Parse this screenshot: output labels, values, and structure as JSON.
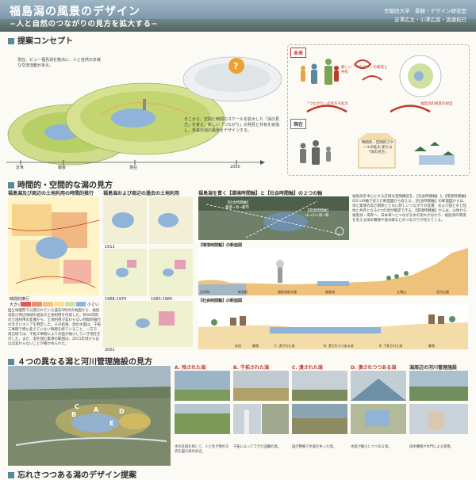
{
  "header": {
    "title": "福島潟の風景のデザイン",
    "subtitle": "−人と自然のつながりの見方を拡大する−",
    "affil_line1": "早稲田大学　景観・デザイン研究室",
    "affil_line2": "吉澤広太・小澤広嵩・渡邉拓巳"
  },
  "sections": {
    "s1": "提案コンセプト",
    "s2": "時間的・空間的な潟の見方",
    "s3": "４つの異なる潟と河川管理施設の見方",
    "s4": "忘れさつつある潟のデザイン提案"
  },
  "concept": {
    "text_now": "現在、ビュー福島潟を拠点に、人と自然の多様な交流活動がある。",
    "text_future": "そこから、空間と時間のスケールを拡大した「潟の見方」を考え、新しい「つながり」の発見と共有を目指し、未来の潟の風景をデザインする。",
    "timeline": [
      "近世",
      "戦後",
      "現在",
      "2050"
    ],
    "future_label": "未来",
    "present_label": "現在",
    "cycle_center": "時間的・空間的スケールの拡大 新たな「潟の見方」",
    "arrow_note_top": "新しい「つながり」の発見と共有",
    "arrow_note_mid": "「つながり」の見方を拡大",
    "arrow_note_bottom": "福島潟の風景の創出"
  },
  "section2": {
    "map_title1": "福島潟及び周辺の土地利用の時間的推行",
    "map_title2": "福島潟および周辺の過去の土地利用",
    "years": [
      "1911",
      "1968-1970",
      "1983-1985",
      "2001"
    ],
    "time_axis": "時間的推行",
    "legend_big": "大きい",
    "legend_small": "小さい",
    "body_text": "国土地理院で公開されている過去5時点の地図から、福島潟及び周辺地域の過去の土地利用を作成した。約90年間の土地利用の変遷から、土地利用が変わらない時間的推行の大きいエリアを特定した。その結果、潟の水面は、干拓工事期で特に変えていない時期を経ていること、一方で、周辺域では、干拓工事期により水面が縮小していき現在を示した。また、潟を囲む集落の範囲は、2011年頃からはほぼ変わらないことが確かめられた。",
    "center_title": "福島潟を貫く【環境時間軸】と【社会時間軸】の２つの軸",
    "axis_env": "【環境時間軸】",
    "axis_soc": "【社会時間軸】",
    "axis_note1": "山→川→潟→海",
    "axis_note2": "集落→潟→都市",
    "right_text": "福島潟を中心とする広域な空間構造を、【社会時間軸】と【環境時間軸】の2つの軸で捉えた断面図から捉える。【社会時間軸】の断面図からは、潟と集落の高さ関係とともに新しいつながりの変遷、および田と水と陸地と共存となる4つの潟が確認できる。【環境時間軸】からは、山地から福島潟・海岸へ、日本海へとつながる水の流れが分かり、福島潟の環境を支える排水機場や放水路などのつながりが見えてくる。",
    "section_env": "【環境時間軸】の断面図",
    "section_soc": "【社会時間軸】の断面図",
    "section_env_labels": [
      "日本海",
      "新潟駅",
      "福島潟放水路",
      "福島潟",
      "五頭山",
      "石切山脈"
    ],
    "section_soc_labels": [
      "本田",
      "集落",
      "C. 潰された潟",
      "D. 潰されつつある潟",
      "B. 干拓された潟",
      "集落"
    ]
  },
  "section3": {
    "aerial_labels": [
      "A",
      "B",
      "C",
      "D",
      "E"
    ],
    "panels": [
      {
        "title": "A. 残された潟",
        "text": "水の区域を残して、人と生き物の交流を図る潟の水辺。"
      },
      {
        "title": "B. 干拓された潟",
        "text": "干拓によってできた田園の潟。"
      },
      {
        "title": "C. 潰された潟",
        "text": "田の整備で水面を失った潟。"
      },
      {
        "title": "D. 潰されつつある潟",
        "text": "水面が縮小しつつある潟。"
      },
      {
        "title": "潟周辺の河川管理施設",
        "text": "排水機場や水門による管理。"
      }
    ],
    "photo_caps": [
      "水の区域",
      "ヨシ原",
      "干拓田",
      "集落",
      "用水路",
      "宅地",
      "排水路",
      "休耕田",
      "水門",
      "排水機場"
    ]
  },
  "colors": {
    "accent": "#5a8a9a",
    "banner": "#7f9aad",
    "lake_blue": "#8fb3d9",
    "field_green": "#b8cf6a",
    "orange": "#e8a33b",
    "red_arrow": "#c0392b"
  }
}
